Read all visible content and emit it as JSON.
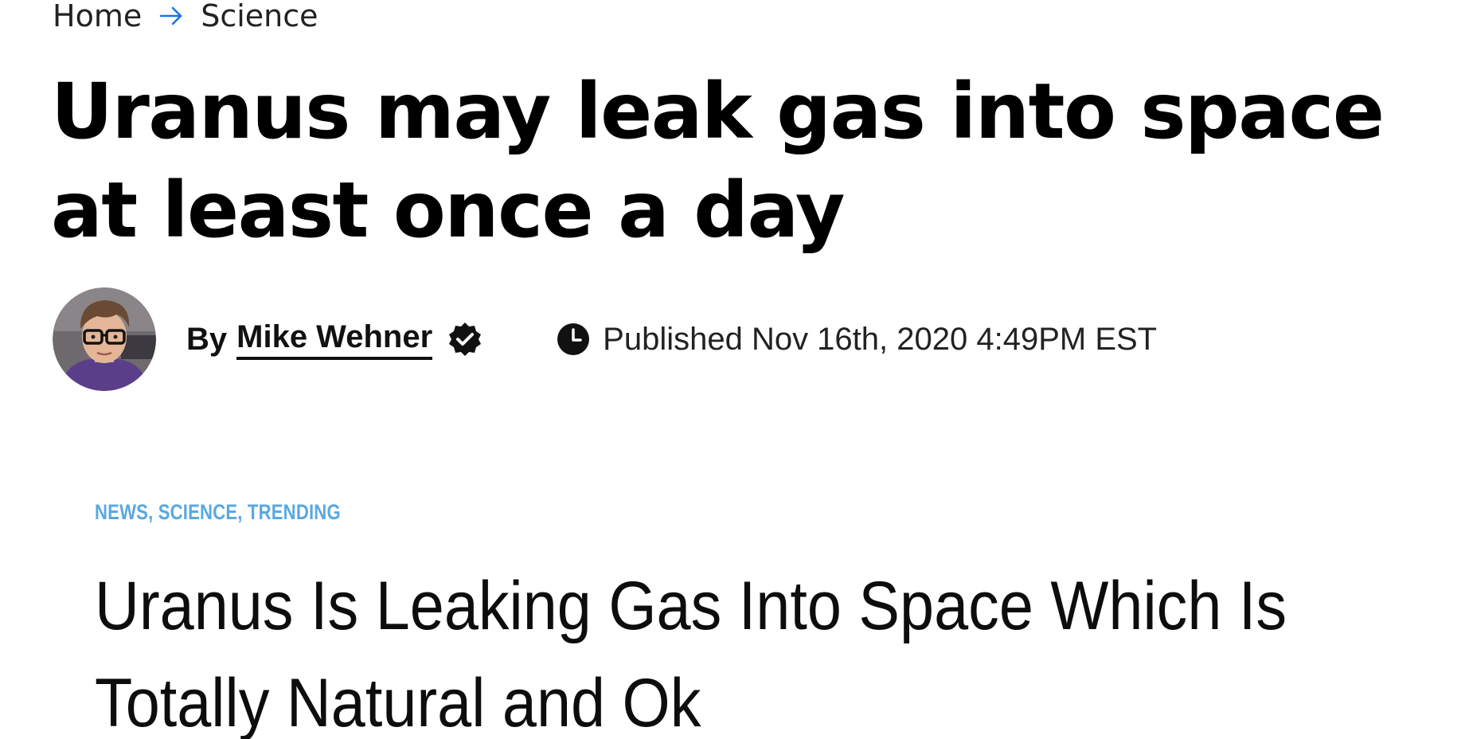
{
  "breadcrumb": {
    "home_label": "Home",
    "separator_icon": "arrow-right-icon",
    "section_label": "Science",
    "separator_color": "#1a73e8"
  },
  "article": {
    "headline_line1": "Uranus may leak gas into space",
    "headline_line2": "at least once a day"
  },
  "byline": {
    "by_label": "By",
    "author_name": "Mike Wehner",
    "verified_icon": "verified-badge-icon",
    "clock_icon": "clock-icon",
    "published_text": "Published Nov 16th, 2020 4:49PM EST"
  },
  "embedded_card": {
    "categories": "NEWS, SCIENCE, TRENDING",
    "category_color": "#5aa8e0",
    "headline_line1": "Uranus Is Leaking Gas Into Space Which Is",
    "headline_line2": "Totally Natural and Ok"
  }
}
